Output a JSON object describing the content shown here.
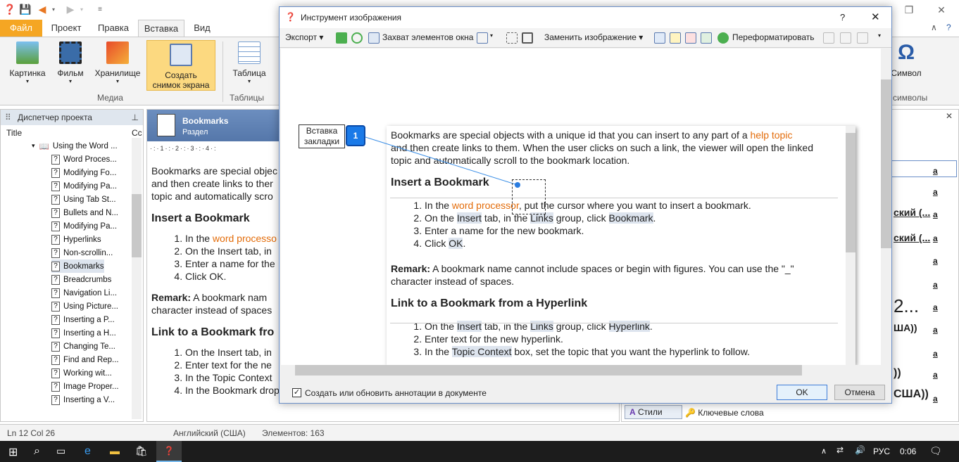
{
  "ribbon_tabs": [
    "Файл",
    "Проект",
    "Правка",
    "Вставка",
    "Вид"
  ],
  "ribbon": {
    "buttons": [
      "Картинка",
      "Фильм",
      "Хранилище",
      "Создать\nснимок экрана",
      "Таблица",
      "Символ"
    ],
    "create_l1": "Создать",
    "create_l2": "снимок экрана",
    "groups": {
      "media": "Медиа",
      "tables": "Таблицы",
      "symbols": "символы"
    }
  },
  "left_panel": {
    "title": "Диспетчер проекта",
    "col_title": "Title",
    "col_c": "Cc",
    "root": "Using the Word ...",
    "items": [
      "Word Proces...",
      "Modifying Fo...",
      "Modifying Pa...",
      "Using Tab St...",
      "Bullets and N...",
      "Modifying Pa...",
      "Hyperlinks",
      "Non-scrollin...",
      "Bookmarks",
      "Breadcrumbs",
      "Navigation Li...",
      "Using Picture...",
      "Inserting a P...",
      "Inserting a H...",
      "Changing Te...",
      "Find and Rep...",
      "Working wit...",
      "Image Proper...",
      "Inserting a V..."
    ]
  },
  "editor": {
    "title": "Bookmarks",
    "subtitle": "Раздел",
    "p1": "Bookmarks are special objec",
    "p1b": "and then create links to ther",
    "p1c": "topic and automatically scro",
    "h1": "Insert a Bookmark",
    "li1a": "In the ",
    "li1b": "word processo",
    "li2": "On the Insert tab, in",
    "li3": "Enter a name for the",
    "li4": "Click OK.",
    "remark": "Remark:",
    "remark_text": " A bookmark nam",
    "remark_b": "character instead of spaces",
    "h2": "Link to a Bookmark fro",
    "l2a": "On the Insert tab, in",
    "l2b": "Enter text for the ne",
    "l2c": "In the Topic Context",
    "l2d": "In the Bookmark drop-down list, select the bookmark that you want. The Bookmark list is"
  },
  "right_panel": {
    "items": [
      "ский (...",
      "ский (...",
      "2...",
      "ША))",
      "))",
      "США))"
    ],
    "tab_styles": "Стили",
    "tab_keywords": "Ключевые слова"
  },
  "status": {
    "pos": "Ln 12 Col 26",
    "lang": "Английский (США)",
    "elements": "Элементов: 163"
  },
  "taskbar": {
    "lang": "РУС",
    "time": "0:06"
  },
  "dialog": {
    "title": "Инструмент изображения",
    "help": "?",
    "toolbar": {
      "export": "Экспорт",
      "capture": "Захват элементов окна",
      "replace": "Заменить изображение",
      "reformat": "Переформатировать"
    },
    "callout_l1": "Вставка",
    "callout_l2": "закладки",
    "callout_num": "1",
    "content": {
      "p1a": "Bookmarks are special objects with a unique id that you can insert to any part of a ",
      "p1link": "help topic",
      "p1b": "and then create links to them. When the user clicks on such a link, the viewer will open the linked",
      "p1c": "topic and automatically scroll to the bookmark location.",
      "h1": "Insert a Bookmark",
      "li1a": "In the ",
      "li1link": "word processor",
      "li1b": ", put the cursor where you want to insert a bookmark.",
      "li2a": "On the ",
      "li2b": "Insert",
      "li2c": " tab, in the ",
      "li2d": "Links",
      "li2e": " group, click ",
      "li2f": "Bookmark",
      "li2g": ".",
      "li3": "Enter a name for the new bookmark.",
      "li4a": "Click ",
      "li4b": "OK",
      "li4c": ".",
      "remark": "Remark:",
      "remark_text": " A bookmark name cannot include spaces or begin with figures. You can use the \"_\"",
      "remark_b": "character instead of spaces.",
      "h2": "Link to a Bookmark from a Hyperlink",
      "l2_1f": "Hyperlink",
      "l2_2": "Enter text for the new hyperlink.",
      "l2_3a": "In the ",
      "l2_3b": "Topic Context",
      "l2_3c": " box, set the topic that you want the hyperlink to follow."
    },
    "checkbox_label": "Создать или обновить аннотации в документе",
    "ok": "OK",
    "cancel": "Отмена"
  }
}
